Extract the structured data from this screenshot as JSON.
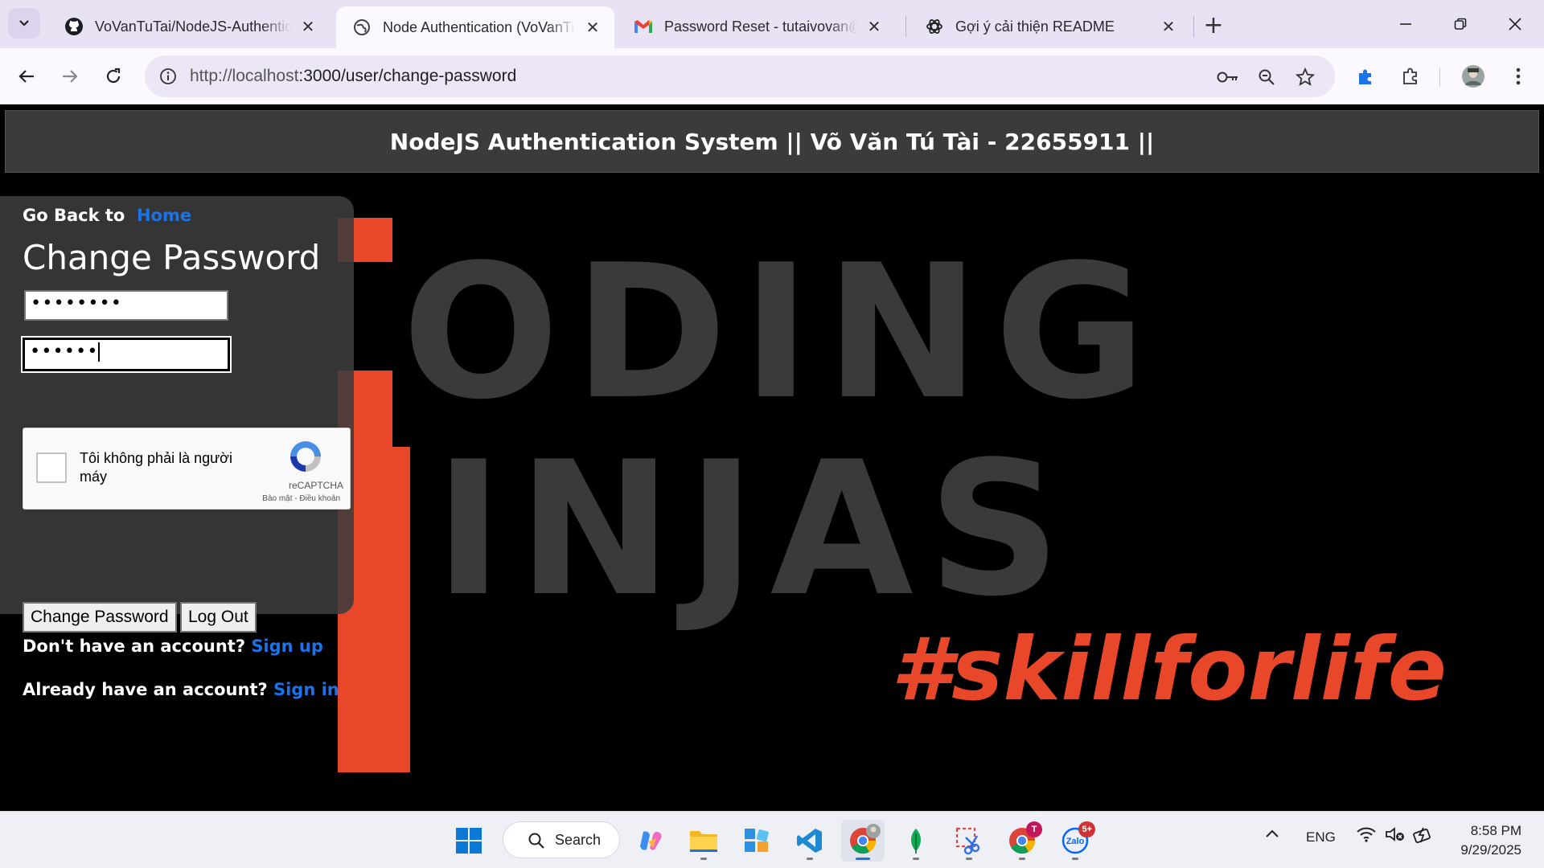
{
  "tabs": [
    {
      "title": "VoVanTuTai/NodeJS-Authentica",
      "icon": "github-icon",
      "active": false
    },
    {
      "title": "Node Authentication (VoVanTuT",
      "icon": "globe-icon",
      "active": true
    },
    {
      "title": "Password Reset - tutaivovan@g",
      "icon": "gmail-icon",
      "active": false
    },
    {
      "title": "Gợi ý cải thiện README",
      "icon": "chatgpt-icon",
      "active": false
    }
  ],
  "address_bar": {
    "host": "http://localhost",
    "rest": ":3000/user/change-password"
  },
  "site": {
    "header_title": "NodeJS Authentication System || Võ Văn Tú Tài - 22655911 ||"
  },
  "background": {
    "row1": "ODING",
    "row2": "INJAS",
    "tagline": "#skillforlife"
  },
  "form": {
    "go_back_label": "Go Back to",
    "home_link": "Home",
    "title": "Change Password",
    "password1_mask": "••••••••",
    "password2_mask": "••••••",
    "captcha_text": "Tôi không phải là người máy",
    "captcha_brand": "reCAPTCHA",
    "captcha_terms": "Bảo mật - Điều khoản",
    "change_button": "Change Password",
    "logout_button": "Log Out",
    "no_account_text": "Don't have an account?",
    "signup_link": "Sign up",
    "have_account_text": "Already have an account?",
    "signin_link": "Sign in"
  },
  "taskbar": {
    "search_label": "Search",
    "lang": "ENG",
    "time": "8:58 PM",
    "date": "9/29/2025",
    "zalo_badge": "5+",
    "chrome_badge": "T"
  },
  "colors": {
    "link": "#1a73e8",
    "accent_orange": "#e8472a",
    "header_bg": "#3b3b3b"
  }
}
